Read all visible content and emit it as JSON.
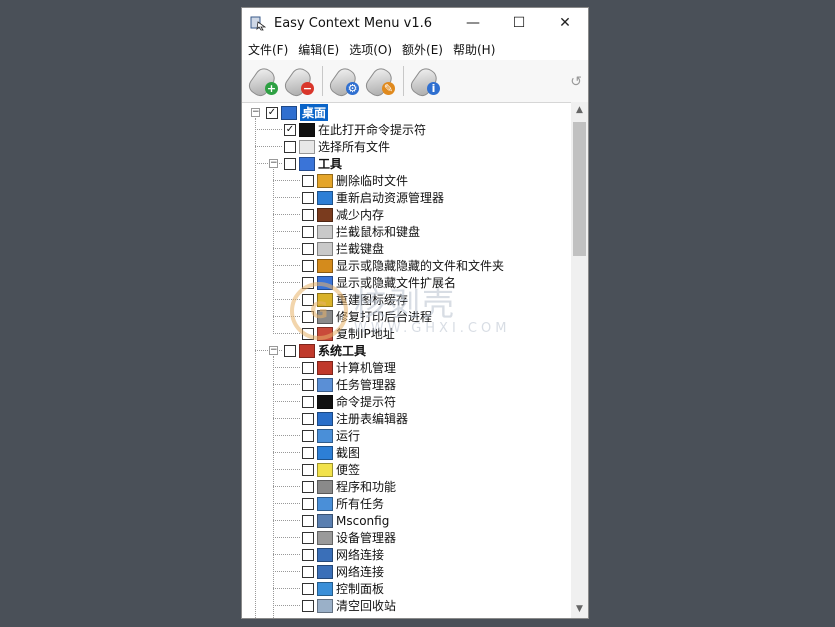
{
  "window": {
    "title": "Easy Context Menu v1.6",
    "minimize": "—",
    "maximize": "☐",
    "close": "✕"
  },
  "menu": [
    "文件(F)",
    "编辑(E)",
    "选项(O)",
    "额外(E)",
    "帮助(H)"
  ],
  "toolbar": {
    "buttons": [
      {
        "name": "add-item-button",
        "badge_color": "#2ea043",
        "glyph": "+"
      },
      {
        "name": "remove-item-button",
        "badge_color": "#d9362b",
        "glyph": "−"
      },
      {
        "name": "settings-button",
        "badge_color": "#2f6fd0",
        "glyph": "⚙"
      },
      {
        "name": "cleanup-button",
        "badge_color": "#e08a1e",
        "glyph": "✎"
      },
      {
        "name": "about-button",
        "badge_color": "#2f6fd0",
        "glyph": "i"
      }
    ],
    "undo_icon": "↺"
  },
  "tree": [
    {
      "label": "桌面",
      "level": 0,
      "checked": true,
      "expanded": true,
      "bold": true,
      "selected": true,
      "icon": "desktop-icon",
      "icon_color": "#2f6fd0"
    },
    {
      "label": "在此打开命令提示符",
      "level": 1,
      "checked": true,
      "icon": "cmd-icon",
      "icon_color": "#111111"
    },
    {
      "label": "选择所有文件",
      "level": 1,
      "checked": false,
      "icon": "document-icon",
      "icon_color": "#e8e8e8"
    },
    {
      "label": "工具",
      "level": 1,
      "checked": false,
      "expanded": true,
      "bold": true,
      "icon": "tools-icon",
      "icon_color": "#3a74d8"
    },
    {
      "label": "删除临时文件",
      "level": 2,
      "checked": false,
      "icon": "broom-icon",
      "icon_color": "#e4a52a"
    },
    {
      "label": "重新启动资源管理器",
      "level": 2,
      "checked": false,
      "icon": "globe-icon",
      "icon_color": "#2d7fd6"
    },
    {
      "label": "减少内存",
      "level": 2,
      "checked": false,
      "icon": "memory-icon",
      "icon_color": "#7a3b1e"
    },
    {
      "label": "拦截鼠标和键盘",
      "level": 2,
      "checked": false,
      "icon": "keyboard-block-icon",
      "icon_color": "#c9c9c9"
    },
    {
      "label": "拦截键盘",
      "level": 2,
      "checked": false,
      "icon": "keyboard-icon",
      "icon_color": "#c9c9c9"
    },
    {
      "label": "显示或隐藏隐藏的文件和文件夹",
      "level": 2,
      "checked": false,
      "icon": "hidden-files-icon",
      "icon_color": "#d48b1c"
    },
    {
      "label": "显示或隐藏文件扩展名",
      "level": 2,
      "checked": false,
      "icon": "extension-icon",
      "icon_color": "#3a74d8"
    },
    {
      "label": "重建图标缓存",
      "level": 2,
      "checked": false,
      "icon": "icon-cache-icon",
      "icon_color": "#d9b22a"
    },
    {
      "label": "修复打印后台进程",
      "level": 2,
      "checked": false,
      "icon": "printer-icon",
      "icon_color": "#8a8a8a"
    },
    {
      "label": "复制IP地址",
      "level": 2,
      "checked": false,
      "icon": "network-ip-icon",
      "icon_color": "#c94a3a"
    },
    {
      "label": "系统工具",
      "level": 1,
      "checked": false,
      "expanded": true,
      "bold": true,
      "icon": "hammer-icon",
      "icon_color": "#c0392b"
    },
    {
      "label": "计算机管理",
      "level": 2,
      "checked": false,
      "icon": "computer-management-icon",
      "icon_color": "#c0392b"
    },
    {
      "label": "任务管理器",
      "level": 2,
      "checked": false,
      "icon": "task-manager-icon",
      "icon_color": "#5a8fd6"
    },
    {
      "label": "命令提示符",
      "level": 2,
      "checked": false,
      "icon": "cmd-icon",
      "icon_color": "#111111"
    },
    {
      "label": "注册表编辑器",
      "level": 2,
      "checked": false,
      "icon": "registry-icon",
      "icon_color": "#2a6fc9"
    },
    {
      "label": "运行",
      "level": 2,
      "checked": false,
      "icon": "run-icon",
      "icon_color": "#4a8fd8"
    },
    {
      "label": "截图",
      "level": 2,
      "checked": false,
      "icon": "snipping-icon",
      "icon_color": "#2d7fd6"
    },
    {
      "label": "便签",
      "level": 2,
      "checked": false,
      "icon": "sticky-note-icon",
      "icon_color": "#f2e24a"
    },
    {
      "label": "程序和功能",
      "level": 2,
      "checked": false,
      "icon": "programs-icon",
      "icon_color": "#8a8a8a"
    },
    {
      "label": "所有任务",
      "level": 2,
      "checked": false,
      "icon": "all-tasks-icon",
      "icon_color": "#4a8fd8"
    },
    {
      "label": "Msconfig",
      "level": 2,
      "checked": false,
      "icon": "msconfig-icon",
      "icon_color": "#5a7fb0"
    },
    {
      "label": "设备管理器",
      "level": 2,
      "checked": false,
      "icon": "device-manager-icon",
      "icon_color": "#9a9a9a"
    },
    {
      "label": "网络连接",
      "level": 2,
      "checked": false,
      "icon": "network-connections-icon",
      "icon_color": "#3a6fb8"
    },
    {
      "label": "网络连接",
      "level": 2,
      "checked": false,
      "icon": "network-icon",
      "icon_color": "#3a6fb8"
    },
    {
      "label": "控制面板",
      "level": 2,
      "checked": false,
      "icon": "control-panel-icon",
      "icon_color": "#3a8fd8"
    },
    {
      "label": "清空回收站",
      "level": 2,
      "checked": false,
      "icon": "recycle-bin-icon",
      "icon_color": "#9ab0c8"
    }
  ],
  "watermark": {
    "logo_glyph": "G",
    "text": "核剥壳",
    "sub": "WWW.GHXI.COM"
  },
  "scrollbar": {
    "up": "▲",
    "down": "▼",
    "position": 0.0
  }
}
